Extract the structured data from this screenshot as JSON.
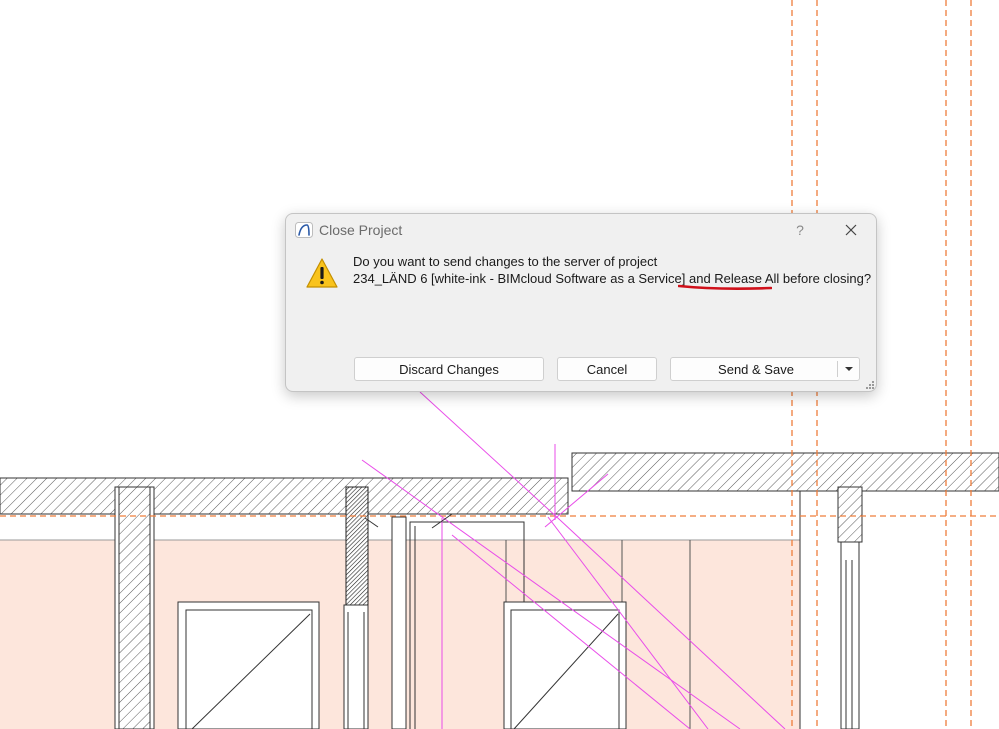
{
  "dialog": {
    "title": "Close Project",
    "app_icon": "archicad-arc-icon",
    "help_label": "?",
    "close_icon": "close-icon",
    "warning_icon": "warning-triangle-icon",
    "message_line1": "Do you want to send changes to the server of project",
    "message_line2": "234_LÄND 6 [white-ink - BIMcloud Software as a Service] and Release All before closing?",
    "buttons": {
      "discard": "Discard Changes",
      "cancel": "Cancel",
      "send_save": "Send & Save"
    },
    "dropdown_icon": "chevron-down-icon",
    "resize_icon": "resize-grip-icon",
    "annotation_color": "#d0111b"
  },
  "colors": {
    "guide_orange": "#ef7d3b",
    "magenta_lines": "#e94ce9",
    "room_fill": "#fde6dc",
    "wall_hatch": "#555555"
  }
}
